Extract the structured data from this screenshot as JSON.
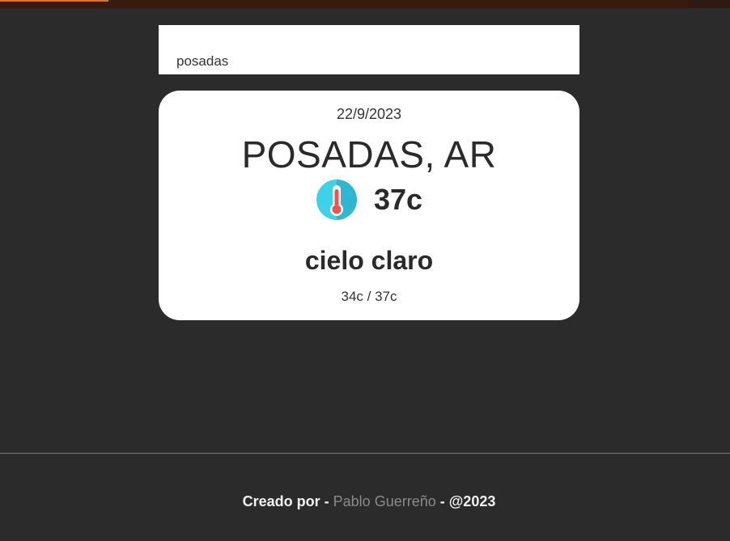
{
  "search": {
    "value": "posadas",
    "placeholder": ""
  },
  "weather": {
    "date": "22/9/2023",
    "location": "POSADAS, AR",
    "icon": "thermometer-icon",
    "temperature": "37c",
    "condition": "cielo claro",
    "min_max": "34c / 37c"
  },
  "footer": {
    "created_by": "Creado por",
    "sep1": " - ",
    "author": "Pablo Guerreño",
    "sep2": " - ",
    "year": "@2023"
  },
  "colors": {
    "background": "#2b2b2b",
    "card": "#ffffff",
    "thermometer_circle": "#3ed1ea",
    "thermometer_red": "#ef5350"
  }
}
